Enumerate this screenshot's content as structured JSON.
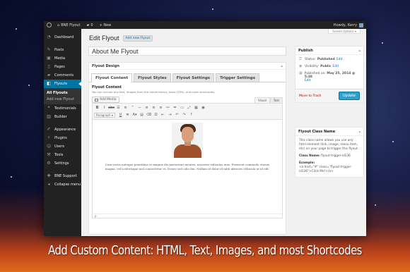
{
  "admin_bar": {
    "site_name": "BNE Flyout",
    "comments_count": "0",
    "new_label": "+ New",
    "greeting": "Howdy, Kerry"
  },
  "sidebar": {
    "items_top": [
      {
        "label": "Dashboard",
        "icon": "dashboard-icon"
      }
    ],
    "items_main": [
      {
        "label": "Posts",
        "icon": "pin-icon"
      },
      {
        "label": "Media",
        "icon": "media-icon"
      },
      {
        "label": "Pages",
        "icon": "page-icon"
      },
      {
        "label": "Comments",
        "icon": "comment-icon"
      }
    ],
    "active_item": {
      "label": "Flyouts",
      "icon": "flyout-icon"
    },
    "submenu": [
      "All Flyouts",
      "Add new Flyout"
    ],
    "items_after": [
      {
        "label": "Testimonials",
        "icon": "testimonial-icon"
      },
      {
        "label": "Builder",
        "icon": "builder-icon"
      }
    ],
    "items_settings": [
      {
        "label": "Appearance",
        "icon": "brush-icon"
      },
      {
        "label": "Plugins",
        "icon": "plugin-icon"
      },
      {
        "label": "Users",
        "icon": "user-icon"
      },
      {
        "label": "Tools",
        "icon": "wrench-icon"
      },
      {
        "label": "Settings",
        "icon": "settings-icon"
      }
    ],
    "items_bottom": [
      {
        "label": "BNE Support",
        "icon": "support-icon"
      },
      {
        "label": "Collapse menu",
        "icon": "collapse-icon"
      }
    ]
  },
  "header": {
    "screen_options": "Screen Options ▾",
    "title": "Edit Flyout",
    "add_new": "Add new Flyout"
  },
  "post_title_value": "About Me Flyout",
  "flyout_design": {
    "heading": "Flyout Design",
    "tabs": [
      "Flyout Content",
      "Flyout Styles",
      "Flyout Settings",
      "Trigger Settings"
    ],
    "section_title": "Flyout Content",
    "section_desc": "You can include any text, images from the media library, basic HTML, and most shortcodes.",
    "add_media": "Add Media",
    "mode_visual": "Visual",
    "mode_text": "Text",
    "format_select": "Paragraph",
    "body_text": "Cum sociis natoque penatibus et magnis dis parturient montes, nascetur ridiculus mus. Praesent commodo cursus magna, vel scelerisque nisl consectetur et. Donec sed odio dui. Nullam id dolor id nibh ultricies vehicula ut id elit.",
    "path": "p"
  },
  "publish": {
    "heading": "Publish",
    "status_label": "Status:",
    "status_value": "Published",
    "visibility_label": "Visibility:",
    "visibility_value": "Public",
    "published_label": "Published on:",
    "published_value": "May 25, 2014 @ 5:38",
    "edit": "Edit",
    "trash": "Move to Trash",
    "update": "Update"
  },
  "class_box": {
    "heading": "Flyout Class Name",
    "desc": "This class name allows you use any html element (link, image, menu item, etc) on your page to trigger this flyout.",
    "class_label": "Class Name:",
    "class_value": "flyout-trigger-id136",
    "example_label": "Example:",
    "example_code": "<a href=\"#\" class=\"flyout-trigger-id136\">Click Me!</a>"
  },
  "caption": "Add Custom Content: HTML, Text, Images, and most Shortcodes"
}
